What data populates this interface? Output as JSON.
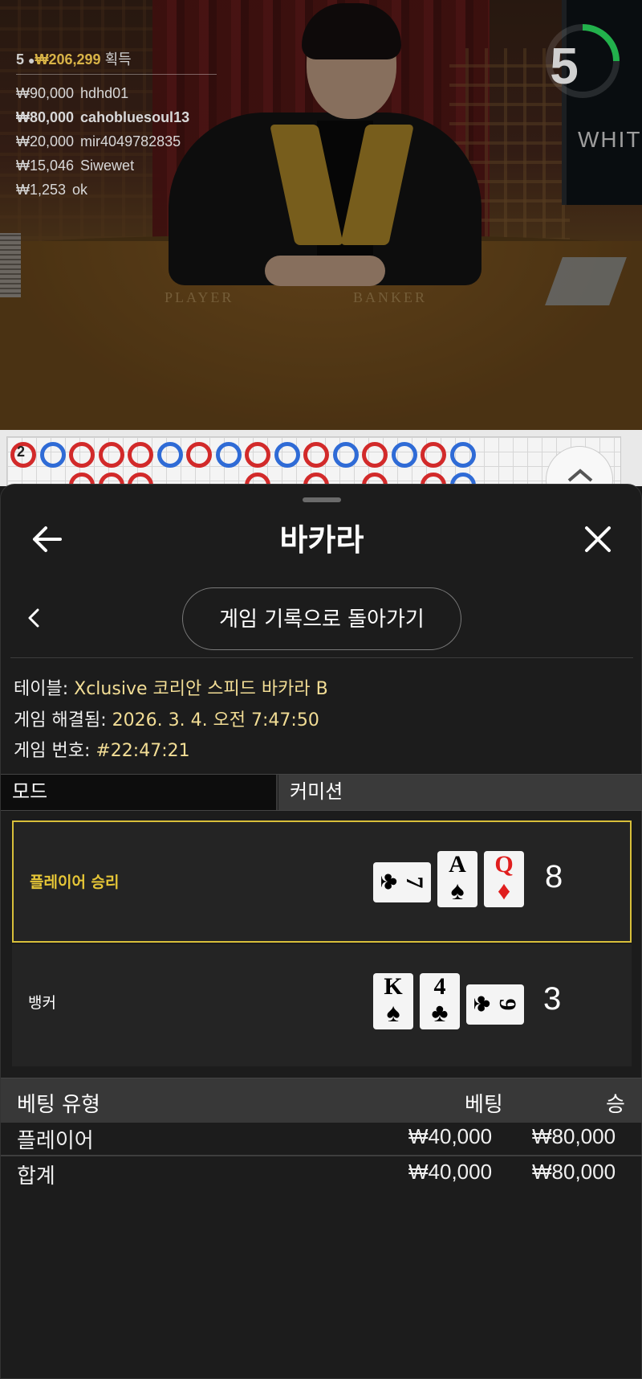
{
  "colors": {
    "accent_gold": "#e6c637",
    "winner_amount": "#d8b347",
    "meta_value": "#f2dd95",
    "timer_green": "#22b14c",
    "road_red": "#d22a2a",
    "road_blue": "#2f6bd6"
  },
  "video": {
    "felt_player": "PLAYER",
    "felt_banker": "BANKER",
    "monitor_text": "WHITE",
    "timer": {
      "value": "5",
      "remaining_fraction": 0.25
    },
    "winners": {
      "count": "5",
      "total": "₩206,299",
      "suffix": "획득",
      "list": [
        {
          "amount": "₩90,000",
          "name": "hdhd01"
        },
        {
          "amount": "₩80,000",
          "name": "cahobluesoul13"
        },
        {
          "amount": "₩20,000",
          "name": "mir4049782835"
        },
        {
          "amount": "₩15,046",
          "name": "Siwewet"
        },
        {
          "amount": "₩1,253",
          "name": "ok"
        }
      ]
    }
  },
  "roadmap": {
    "top_row": [
      "B",
      "P",
      "B",
      "B",
      "B",
      "P",
      "B",
      "P",
      "B",
      "P",
      "B",
      "P",
      "B",
      "P",
      "B",
      "P"
    ],
    "note": "2"
  },
  "panel": {
    "title": "바카라",
    "history_button": "게임 기록으로 돌아가기",
    "table_label": "테이블:",
    "table_value": "Xclusive 코리안 스피드 바카라 B",
    "resolved_label": "게임 해결됨:",
    "resolved_value": "2026. 3. 4. 오전 7:47:50",
    "number_label": "게임 번호:",
    "number_value": "#22:47:21",
    "mode_label": "모드",
    "commission_label": "커미션"
  },
  "results": {
    "player": {
      "label": "플레이어 승리",
      "score": "8",
      "cards": [
        {
          "rank": "7",
          "suit": "♣",
          "red": false
        },
        {
          "rank": "A",
          "suit": "♠",
          "red": false
        },
        {
          "rank": "Q",
          "suit": "♦",
          "red": true
        }
      ]
    },
    "banker": {
      "label": "뱅커",
      "score": "3",
      "cards": [
        {
          "rank": "K",
          "suit": "♠",
          "red": false
        },
        {
          "rank": "4",
          "suit": "♣",
          "red": false
        },
        {
          "rank": "9",
          "suit": "♣",
          "red": false
        }
      ]
    }
  },
  "bets": {
    "head_type": "베팅 유형",
    "head_bet": "베팅",
    "head_win": "승",
    "rows": [
      {
        "type": "플레이어",
        "bet": "₩40,000",
        "win": "₩80,000"
      }
    ],
    "total": {
      "type": "합계",
      "bet": "₩40,000",
      "win": "₩80,000"
    }
  },
  "icons": {
    "back": "arrow-left-icon",
    "close": "close-icon",
    "prev": "chevron-left-icon",
    "roadmap_toggle": "chevron-up-icon"
  }
}
